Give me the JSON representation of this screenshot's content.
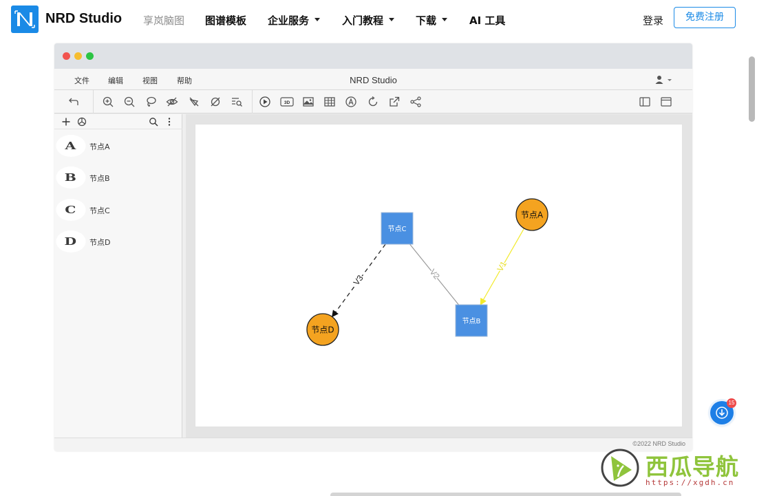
{
  "site_nav": {
    "brand": "NRD Studio",
    "items": [
      {
        "label": "享岚脑图",
        "style": "muted",
        "dropdown": false
      },
      {
        "label": "图谱模板",
        "style": "bold",
        "dropdown": false
      },
      {
        "label": "企业服务",
        "style": "bold",
        "dropdown": true
      },
      {
        "label": "入门教程",
        "style": "bold",
        "dropdown": true
      },
      {
        "label": "下载",
        "style": "bold",
        "dropdown": true
      },
      {
        "label": "AI 工具",
        "style": "bold",
        "dropdown": false
      }
    ],
    "login": "登录",
    "signup": "免费注册",
    "accent_color": "#1a8ae6"
  },
  "app": {
    "title": "NRD Studio",
    "menu": [
      "文件",
      "编辑",
      "视图",
      "帮助"
    ],
    "toolbar_icons": [
      "undo-icon",
      "zoom-in-icon",
      "zoom-out-icon",
      "lasso-icon",
      "hide-icon",
      "filter-icon",
      "clear-icon",
      "search-list-icon",
      "play-icon",
      "3d-view-icon",
      "image-icon",
      "table-icon",
      "layout-icon",
      "refresh-icon",
      "export-icon",
      "share-icon",
      "sidebar-toggle-icon",
      "window-icon"
    ],
    "toolbar_3d_label": "3D",
    "sidebar_nodes": [
      {
        "badge": "A",
        "label": "节点A"
      },
      {
        "badge": "B",
        "label": "节点B"
      },
      {
        "badge": "C",
        "label": "节点C"
      },
      {
        "badge": "D",
        "label": "节点D"
      }
    ],
    "copyright": "©2022 NRD Studio"
  },
  "graph": {
    "nodes": [
      {
        "id": "A",
        "label": "节点A",
        "shape": "circle",
        "color": "#f4a320"
      },
      {
        "id": "B",
        "label": "节点B",
        "shape": "square",
        "color": "#4a90e2"
      },
      {
        "id": "C",
        "label": "节点C",
        "shape": "square",
        "color": "#4a90e2"
      },
      {
        "id": "D",
        "label": "节点D",
        "shape": "circle",
        "color": "#f4a320"
      }
    ],
    "edges": [
      {
        "from": "A",
        "to": "B",
        "label": "V1",
        "style": "solid",
        "color": "#f2ea2a",
        "arrow": true
      },
      {
        "from": "C",
        "to": "B",
        "label": "V2",
        "style": "solid",
        "color": "#9a9a9a",
        "arrow": false
      },
      {
        "from": "C",
        "to": "D",
        "label": "V3",
        "style": "dashed",
        "color": "#222222",
        "arrow": true
      }
    ]
  },
  "float_widget": {
    "count": "15",
    "icon": "download-icon"
  },
  "watermark": {
    "text": "西瓜导航",
    "url": "https://xgdh.cn"
  }
}
